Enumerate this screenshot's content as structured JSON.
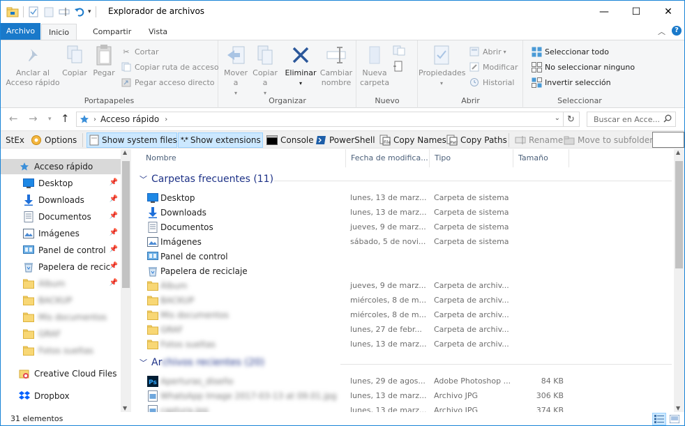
{
  "window": {
    "title": "Explorador de archivos",
    "minimize": "—",
    "maximize": "☐",
    "close": "✕"
  },
  "ribbon_tabs": [
    "Archivo",
    "Inicio",
    "Compartir",
    "Vista"
  ],
  "ribbon": {
    "portapapeles": {
      "label": "Portapapeles",
      "pin": "Anclar al Acceso rápido",
      "copy": "Copiar",
      "paste": "Pegar",
      "cut": "Cortar",
      "copy_path": "Copiar ruta de acceso",
      "paste_shortcut": "Pegar acceso directo"
    },
    "organizar": {
      "label": "Organizar",
      "move_to": "Mover a",
      "copy_to": "Copiar a",
      "delete": "Eliminar",
      "rename": "Cambiar nombre"
    },
    "nuevo": {
      "label": "Nuevo",
      "new_folder": "Nueva carpeta"
    },
    "abrir": {
      "label": "Abrir",
      "properties": "Propiedades",
      "open": "Abrir",
      "edit": "Modificar",
      "history": "Historial"
    },
    "seleccionar": {
      "label": "Seleccionar",
      "select_all": "Seleccionar todo",
      "select_none": "No seleccionar ninguno",
      "invert": "Invertir selección"
    }
  },
  "address": {
    "path": "Acceso rápido",
    "search_placeholder": "Buscar en Acce..."
  },
  "stex": {
    "label": "StEx",
    "options": "Options",
    "show_system": "Show system files",
    "show_ext": "Show extensions",
    "console": "Console",
    "powershell": "PowerShell",
    "copy_names": "Copy Names",
    "copy_paths": "Copy Paths",
    "rename": "Rename",
    "move_sub": "Move to subfolder"
  },
  "nav": {
    "quick_access": "Acceso rápido",
    "items": [
      {
        "label": "Desktop",
        "icon": "desktop-icon",
        "pinned": true
      },
      {
        "label": "Downloads",
        "icon": "download-icon",
        "pinned": true
      },
      {
        "label": "Documentos",
        "icon": "document-icon",
        "pinned": true
      },
      {
        "label": "Imágenes",
        "icon": "image-icon",
        "pinned": true
      },
      {
        "label": "Panel de control",
        "icon": "control-panel-icon",
        "pinned": true
      },
      {
        "label": "Papelera de reciclaje",
        "icon": "recycle-bin-icon",
        "pinned": true
      },
      {
        "label": "Álbum",
        "icon": "folder-icon",
        "pinned": true,
        "blurred": true
      },
      {
        "label": "BACKUP",
        "icon": "folder-icon",
        "pinned": false,
        "blurred": true
      },
      {
        "label": "Mis documentos",
        "icon": "folder-icon",
        "pinned": false,
        "blurred": true
      },
      {
        "label": "GRAF",
        "icon": "folder-icon",
        "pinned": false,
        "blurred": true
      },
      {
        "label": "Fotos sueltas",
        "icon": "folder-icon",
        "pinned": false,
        "blurred": true
      }
    ],
    "creative_cloud": "Creative Cloud Files",
    "dropbox": "Dropbox"
  },
  "columns": [
    "Nombre",
    "Fecha de modifica...",
    "Tipo",
    "Tamaño"
  ],
  "frequent": {
    "header": "Carpetas frecuentes (11)",
    "rows": [
      {
        "name": "Desktop",
        "date": "lunes, 13 de marz...",
        "type": "Carpeta de sistema",
        "icon": "desktop-icon"
      },
      {
        "name": "Downloads",
        "date": "lunes, 13 de marz...",
        "type": "Carpeta de sistema",
        "icon": "download-icon"
      },
      {
        "name": "Documentos",
        "date": "jueves, 9 de marz...",
        "type": "Carpeta de sistema",
        "icon": "document-icon"
      },
      {
        "name": "Imágenes",
        "date": "sábado, 5 de novi...",
        "type": "Carpeta de sistema",
        "icon": "image-icon"
      },
      {
        "name": "Panel de control",
        "date": "",
        "type": "",
        "icon": "control-panel-icon"
      },
      {
        "name": "Papelera de reciclaje",
        "date": "",
        "type": "",
        "icon": "recycle-bin-icon"
      },
      {
        "name": "Álbum",
        "date": "jueves, 9 de marz...",
        "type": "Carpeta de archiv...",
        "icon": "folder-icon",
        "blurred": true
      },
      {
        "name": "BACKUP",
        "date": "miércoles, 8 de m...",
        "type": "Carpeta de archiv...",
        "icon": "folder-icon",
        "blurred": true
      },
      {
        "name": "Mis documentos",
        "date": "miércoles, 8 de m...",
        "type": "Carpeta de archiv...",
        "icon": "folder-icon",
        "blurred": true
      },
      {
        "name": "GRAF",
        "date": "lunes, 27 de febr...",
        "type": "Carpeta de archiv...",
        "icon": "folder-icon",
        "blurred": true
      },
      {
        "name": "Fotos sueltas",
        "date": "lunes, 13 de marz...",
        "type": "Carpeta de archiv...",
        "icon": "folder-icon",
        "blurred": true
      }
    ]
  },
  "recent": {
    "header_prefix": "Ar",
    "header_rest": "chivos recientes (20)",
    "rows": [
      {
        "name": "Aperturas_diseño",
        "date": "lunes, 29 de agos...",
        "type": "Adobe Photoshop ...",
        "size": "84 KB",
        "icon": "photoshop-icon"
      },
      {
        "name": "WhatsApp Image 2017-03-13 at 09.01.jpg",
        "date": "lunes, 13 de marz...",
        "type": "Archivo JPG",
        "size": "306 KB",
        "icon": "jpg-icon"
      },
      {
        "name": "captura.jpg",
        "date": "lunes, 13 de marz...",
        "type": "Archivo JPG",
        "size": "374 KB",
        "icon": "jpg-icon"
      }
    ]
  },
  "status": {
    "count": "31 elementos"
  },
  "colors": {
    "accent": "#1979ca",
    "selection": "#cce8ff",
    "group_header": "#1e3287",
    "folder": "#f8d775"
  }
}
